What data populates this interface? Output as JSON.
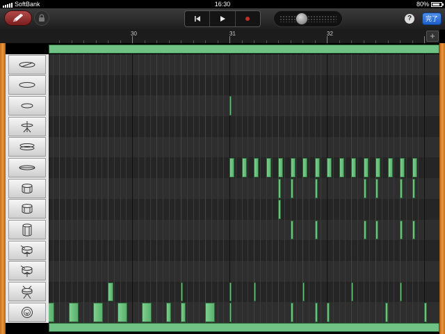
{
  "status_bar": {
    "carrier": "SoftBank",
    "time": "16:30",
    "battery": "80%",
    "battery_level": 0.8
  },
  "toolbar": {
    "pencil_icon": "pencil-icon",
    "lock_icon": "lock-icon",
    "transport": {
      "rewind_icon": "skip-back-icon",
      "play_icon": "play-icon",
      "record_icon": "record-icon",
      "record_color": "#c0302b"
    },
    "volume_level": 0.35,
    "help_label": "?",
    "done_label": "完了"
  },
  "ruler": {
    "bars": [
      "30",
      "31",
      "32"
    ],
    "add_label": "+"
  },
  "accent_color": "#6fc283",
  "drum_rows": [
    {
      "name": "crash-cymbal",
      "icon": "crash-cymbal-icon"
    },
    {
      "name": "ride-cymbal",
      "icon": "ride-cymbal-icon"
    },
    {
      "name": "ride-bell",
      "icon": "ride-bell-icon"
    },
    {
      "name": "hihat-pedal",
      "icon": "hihat-pedal-icon"
    },
    {
      "name": "hihat-open",
      "icon": "hihat-open-icon"
    },
    {
      "name": "hihat-closed",
      "icon": "hihat-closed-icon"
    },
    {
      "name": "tom-high",
      "icon": "tom-high-icon"
    },
    {
      "name": "tom-mid",
      "icon": "tom-mid-icon"
    },
    {
      "name": "floor-tom",
      "icon": "floor-tom-icon"
    },
    {
      "name": "snare-rim",
      "icon": "snare-rim-icon"
    },
    {
      "name": "snare",
      "icon": "snare-icon"
    },
    {
      "name": "snare-stand",
      "icon": "snare-stand-icon"
    },
    {
      "name": "kick-drum",
      "icon": "kick-drum-icon"
    }
  ],
  "notes": {
    "2": [
      [
        31.0,
        0.02
      ]
    ],
    "5": [
      [
        31.0,
        0.05
      ],
      [
        31.125,
        0.05
      ],
      [
        31.25,
        0.05
      ],
      [
        31.375,
        0.05
      ],
      [
        31.5,
        0.05
      ],
      [
        31.625,
        0.05
      ],
      [
        31.75,
        0.05
      ],
      [
        31.875,
        0.05
      ],
      [
        32.0,
        0.05
      ],
      [
        32.125,
        0.05
      ],
      [
        32.25,
        0.05
      ],
      [
        32.375,
        0.05
      ],
      [
        32.5,
        0.05
      ],
      [
        32.625,
        0.05
      ],
      [
        32.75,
        0.05
      ],
      [
        32.875,
        0.05
      ]
    ],
    "6": [
      [
        31.5,
        0.03
      ],
      [
        31.625,
        0.03
      ],
      [
        31.875,
        0.03
      ],
      [
        32.375,
        0.03
      ],
      [
        32.5,
        0.03
      ],
      [
        32.75,
        0.03
      ],
      [
        32.875,
        0.03
      ]
    ],
    "7": [
      [
        31.5,
        0.03
      ]
    ],
    "8": [
      [
        31.625,
        0.03
      ],
      [
        31.875,
        0.03
      ],
      [
        32.375,
        0.03
      ],
      [
        32.5,
        0.03
      ],
      [
        32.75,
        0.03
      ],
      [
        32.875,
        0.03
      ]
    ],
    "11": [
      [
        29.75,
        0.06
      ],
      [
        30.5,
        0.02
      ],
      [
        31.0,
        0.02
      ],
      [
        31.25,
        0.02
      ],
      [
        31.75,
        0.02
      ],
      [
        32.25,
        0.02
      ],
      [
        32.75,
        0.02
      ]
    ],
    "12": [
      [
        29.1,
        0.1
      ],
      [
        29.35,
        0.1
      ],
      [
        29.6,
        0.1
      ],
      [
        29.85,
        0.1
      ],
      [
        30.1,
        0.1
      ],
      [
        30.35,
        0.05
      ],
      [
        30.5,
        0.05
      ],
      [
        30.75,
        0.1
      ],
      [
        31.0,
        0.02
      ],
      [
        31.625,
        0.03
      ],
      [
        31.875,
        0.03
      ],
      [
        32.0,
        0.03
      ],
      [
        32.6,
        0.03
      ],
      [
        33.0,
        0.03
      ]
    ]
  }
}
